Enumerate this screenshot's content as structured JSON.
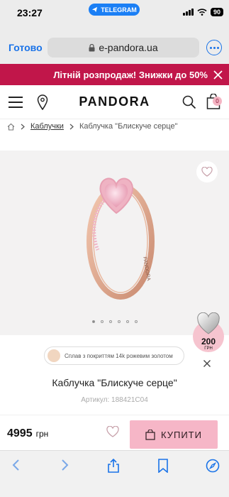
{
  "status_bar": {
    "time": "23:27",
    "pill_label": "TELEGRAM",
    "battery": "90"
  },
  "browser": {
    "done_label": "Готово",
    "url": "e-pandora.ua"
  },
  "promo": {
    "text": "Літній розпродаж! Знижки до 50%"
  },
  "header": {
    "logo": "PANDORA",
    "cart_count": "0"
  },
  "breadcrumb": {
    "category": "Каблучки",
    "current": "Каблучка \"Блискуче серце\""
  },
  "gallery": {
    "image_count": 6,
    "active_index": 0
  },
  "points": {
    "value": "200",
    "currency": "ГРН"
  },
  "product": {
    "material": "Сплав з покриттям 14k рожевим золотом",
    "title": "Каблучка \"Блискуче серце\"",
    "sku": "Артикул: 188421C04",
    "price": "4995",
    "price_currency": "грн",
    "buy_label": "КУПИТИ"
  },
  "colors": {
    "promo_bg": "#c1164a",
    "buy_bg": "#f6b6c7",
    "link": "#1a73e8",
    "points_bg": "#f6c4cf"
  },
  "icons": [
    "telegram-icon",
    "signal-icon",
    "wifi-icon",
    "lock-icon",
    "more-icon",
    "close-icon",
    "menu-icon",
    "location-pin-icon",
    "search-icon",
    "shopping-bag-icon",
    "home-icon",
    "chevron-right-icon",
    "heart-icon",
    "ring-image",
    "bag-icon",
    "back-icon",
    "forward-icon",
    "share-icon",
    "bookmarks-icon",
    "compass-icon"
  ]
}
